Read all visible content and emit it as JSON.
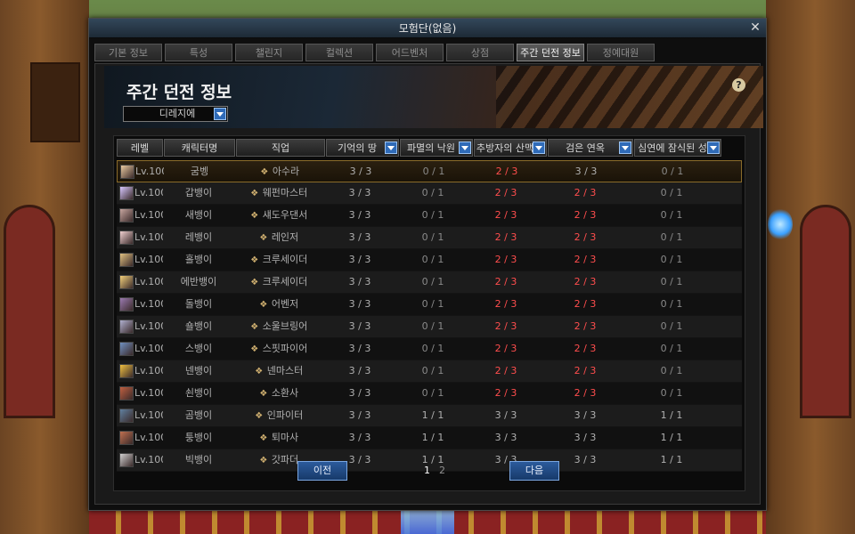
{
  "window": {
    "title": "모험단(없음)"
  },
  "tabs": [
    "기본 정보",
    "특성",
    "챌린지",
    "컬렉션",
    "어드벤처",
    "상점",
    "주간 던전 정보",
    "정예대원"
  ],
  "active_tab": 6,
  "page_title": "주간 던전 정보",
  "dungeon_select": {
    "value": "디레지에"
  },
  "columns": [
    "레벨",
    "캐릭터명",
    "직업",
    "기억의 땅",
    "파멸의 낙원",
    "추방자의 산맥",
    "검은 연옥",
    "심연에 잠식된 성"
  ],
  "rows": [
    {
      "level": "Lv.100",
      "name": "굼벵",
      "job": "아수라",
      "d": [
        "3 / 3",
        "0 / 1",
        "2 / 3",
        "3 / 3",
        "0 / 1"
      ]
    },
    {
      "level": "Lv.100",
      "name": "갑뱅이",
      "job": "웨펀마스터",
      "d": [
        "3 / 3",
        "0 / 1",
        "2 / 3",
        "2 / 3",
        "0 / 1"
      ]
    },
    {
      "level": "Lv.100",
      "name": "새뱅이",
      "job": "섀도우댄서",
      "d": [
        "3 / 3",
        "0 / 1",
        "2 / 3",
        "2 / 3",
        "0 / 1"
      ]
    },
    {
      "level": "Lv.100",
      "name": "레뱅이",
      "job": "레인저",
      "d": [
        "3 / 3",
        "0 / 1",
        "2 / 3",
        "2 / 3",
        "0 / 1"
      ]
    },
    {
      "level": "Lv.100",
      "name": "홀뱅이",
      "job": "크루세이더",
      "d": [
        "3 / 3",
        "0 / 1",
        "2 / 3",
        "2 / 3",
        "0 / 1"
      ]
    },
    {
      "level": "Lv.100",
      "name": "에반뱅이",
      "job": "크루세이더",
      "d": [
        "3 / 3",
        "0 / 1",
        "2 / 3",
        "2 / 3",
        "0 / 1"
      ]
    },
    {
      "level": "Lv.100",
      "name": "돌뱅이",
      "job": "어벤저",
      "d": [
        "3 / 3",
        "0 / 1",
        "2 / 3",
        "2 / 3",
        "0 / 1"
      ]
    },
    {
      "level": "Lv.100",
      "name": "숄뱅이",
      "job": "소울브링어",
      "d": [
        "3 / 3",
        "0 / 1",
        "2 / 3",
        "2 / 3",
        "0 / 1"
      ]
    },
    {
      "level": "Lv.100",
      "name": "스뱅이",
      "job": "스핏파이어",
      "d": [
        "3 / 3",
        "0 / 1",
        "2 / 3",
        "2 / 3",
        "0 / 1"
      ]
    },
    {
      "level": "Lv.100",
      "name": "넨뱅이",
      "job": "넨마스터",
      "d": [
        "3 / 3",
        "0 / 1",
        "2 / 3",
        "2 / 3",
        "0 / 1"
      ]
    },
    {
      "level": "Lv.100",
      "name": "쇤뱅이",
      "job": "소환사",
      "d": [
        "3 / 3",
        "0 / 1",
        "2 / 3",
        "2 / 3",
        "0 / 1"
      ]
    },
    {
      "level": "Lv.100",
      "name": "곰뱅이",
      "job": "인파이터",
      "d": [
        "3 / 3",
        "1 / 1",
        "3 / 3",
        "3 / 3",
        "1 / 1"
      ]
    },
    {
      "level": "Lv.100",
      "name": "퉁뱅이",
      "job": "퇴마사",
      "d": [
        "3 / 3",
        "1 / 1",
        "3 / 3",
        "3 / 3",
        "1 / 1"
      ]
    },
    {
      "level": "Lv.100",
      "name": "빅뱅이",
      "job": "갓파더",
      "d": [
        "3 / 3",
        "1 / 1",
        "3 / 3",
        "3 / 3",
        "1 / 1"
      ]
    }
  ],
  "pager": {
    "prev": "이전",
    "next": "다음",
    "pages": [
      "1",
      "2"
    ],
    "current": "1"
  },
  "icons": {
    "close": "close-icon",
    "help": "help-icon",
    "sort": "chevron-down-icon",
    "job": "job-icon"
  },
  "colors": {
    "incomplete": "#ff4d4d",
    "accent": "#2f6bb8",
    "selected_border": "#8a6b2a"
  }
}
